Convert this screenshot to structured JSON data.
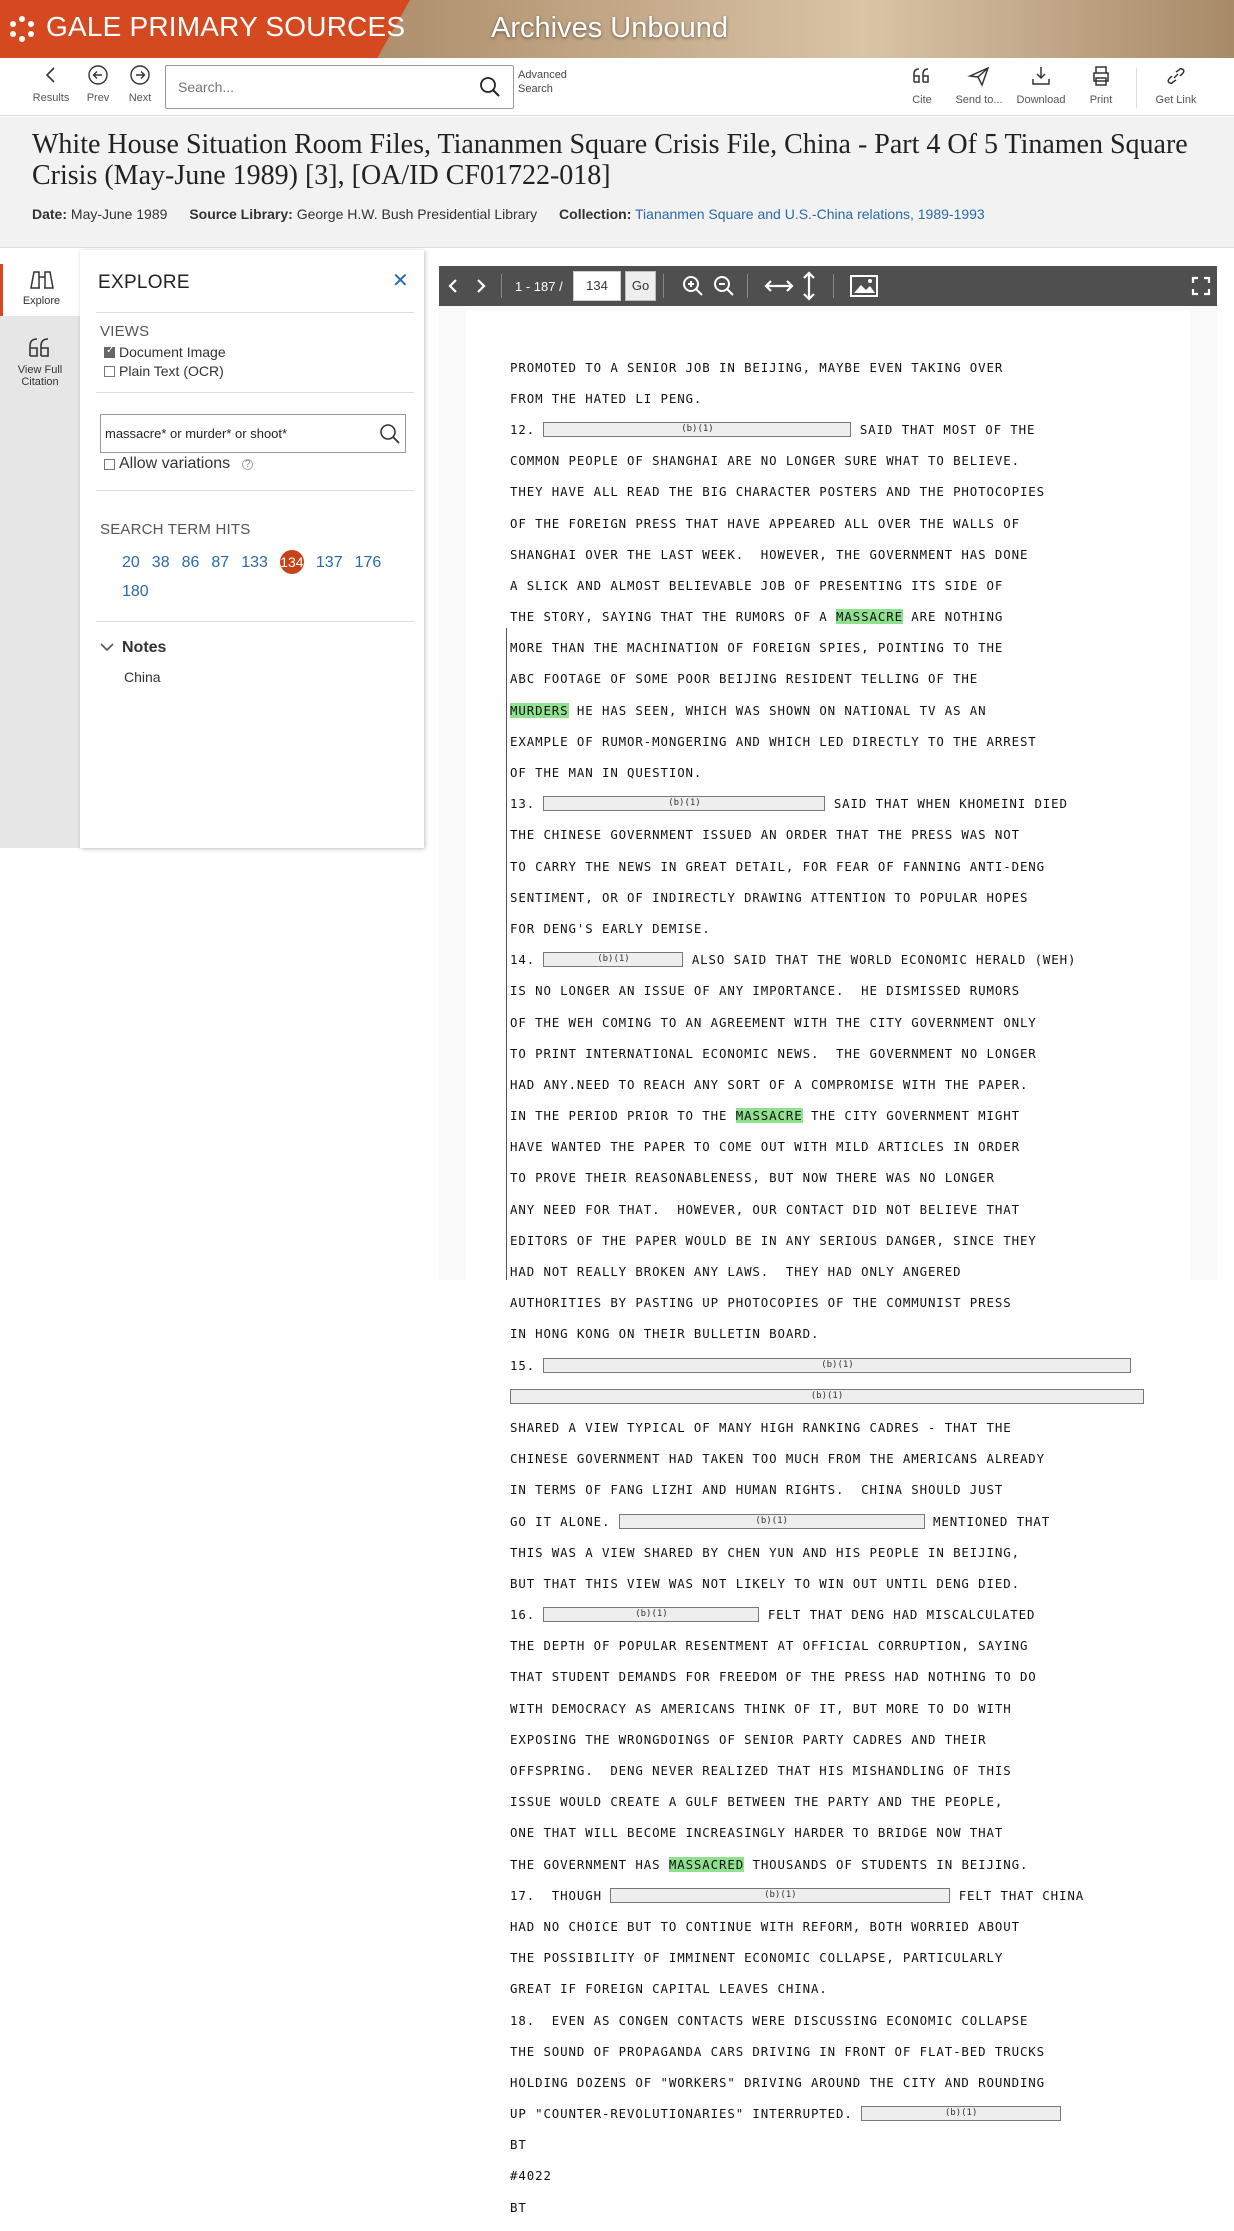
{
  "banner": {
    "brand": "GALE PRIMARY SOURCES",
    "archives": "Archives Unbound"
  },
  "toolbar": {
    "results": "Results",
    "prev": "Prev",
    "next": "Next",
    "search_placeholder": "Search...",
    "advanced_line1": "Advanced",
    "advanced_line2": "Search",
    "cite": "Cite",
    "send": "Send to...",
    "download": "Download",
    "print": "Print",
    "getlink": "Get Link"
  },
  "doc": {
    "title": "White House Situation Room Files, Tiananmen Square Crisis File, China - Part 4 Of 5 Tinamen Square Crisis (May-June 1989) [3], [OA/ID CF01722-018]",
    "date_label": "Date:",
    "date": "May-June 1989",
    "source_label": "Source Library:",
    "source": "George H.W. Bush Presidential Library",
    "collection_label": "Collection:",
    "collection": "Tiananmen Square and U.S.-China relations, 1989-1993"
  },
  "rail": {
    "explore": "Explore",
    "citation_line1": "View Full",
    "citation_line2": "Citation"
  },
  "explore": {
    "title": "EXPLORE",
    "views": "VIEWS",
    "view_doc": "Document Image",
    "view_ocr": "Plain Text (OCR)",
    "search_value": "massacre* or murder* or shoot*",
    "allow": "Allow variations",
    "hits_title": "SEARCH TERM HITS",
    "hits": [
      "20",
      "38",
      "86",
      "87",
      "133",
      "134",
      "137",
      "176",
      "180"
    ],
    "current_hit": "134",
    "notes": "Notes",
    "note_item": "China"
  },
  "viewer": {
    "range": "1 - 187 /",
    "page": "134",
    "go": "Go"
  },
  "redaction": "(b)(1)",
  "colors": {
    "brand_orange": "#d4491f",
    "link": "#2a6aa8",
    "highlight": "#8fe08f",
    "viewer_bar": "#4f4f4f"
  }
}
